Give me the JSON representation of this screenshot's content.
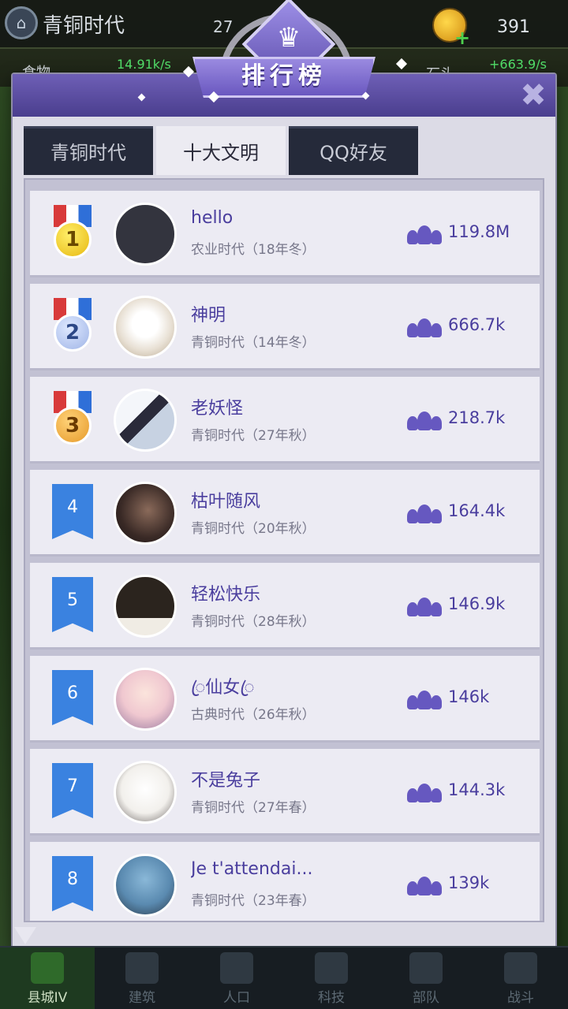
{
  "background": {
    "age_title": "青铜时代",
    "mid_value": "27",
    "coin_count": "391",
    "food_label": "食物",
    "food_rate": "14.91k/s",
    "stone_label": "石头",
    "stone_rate": "+663.9/s"
  },
  "modal": {
    "title": "排行榜",
    "close_glyph": "✖",
    "crown_glyph": "♛",
    "tabs": [
      {
        "label": "青铜时代",
        "active": false
      },
      {
        "label": "十大文明",
        "active": true
      },
      {
        "label": "QQ好友",
        "active": false
      }
    ]
  },
  "leaderboard": [
    {
      "rank": "1",
      "name": "hello",
      "era": "农业时代（18年冬）",
      "population": "119.8M",
      "avatar_color": "#33343e"
    },
    {
      "rank": "2",
      "name": "神明",
      "era": "青铜时代（14年冬）",
      "population": "666.7k",
      "avatar_color": "#e8e0d4"
    },
    {
      "rank": "3",
      "name": "老妖怪",
      "era": "青铜时代（27年秋）",
      "population": "218.7k",
      "avatar_color": "#c7d2e2"
    },
    {
      "rank": "4",
      "name": "枯叶随风",
      "era": "青铜时代（20年秋）",
      "population": "164.4k",
      "avatar_color": "#4a3a36"
    },
    {
      "rank": "5",
      "name": "轻松快乐",
      "era": "青铜时代（28年秋）",
      "population": "146.9k",
      "avatar_color": "#2b241e"
    },
    {
      "rank": "6",
      "name": "ꦿ仙女ꦿ",
      "era": "古典时代（26年秋）",
      "population": "146k",
      "avatar_color": "#f0c8d0"
    },
    {
      "rank": "7",
      "name": "不是兔子",
      "era": "青铜时代（27年春）",
      "population": "144.3k",
      "avatar_color": "#f2f0ec"
    },
    {
      "rank": "8",
      "name": "Je t'attendai...",
      "era": "青铜时代（23年春）",
      "population": "139k",
      "avatar_color": "#5a8ab0"
    }
  ],
  "bottom_nav": [
    {
      "label": "县城IV",
      "active": true
    },
    {
      "label": "建筑",
      "active": false
    },
    {
      "label": "人口",
      "active": false
    },
    {
      "label": "科技",
      "active": false
    },
    {
      "label": "部队",
      "active": false
    },
    {
      "label": "战斗",
      "active": false
    }
  ],
  "colors": {
    "accent_purple": "#4a3e9e",
    "rank_flag_blue": "#3a82e0",
    "header_purple": "#5e4fae"
  }
}
